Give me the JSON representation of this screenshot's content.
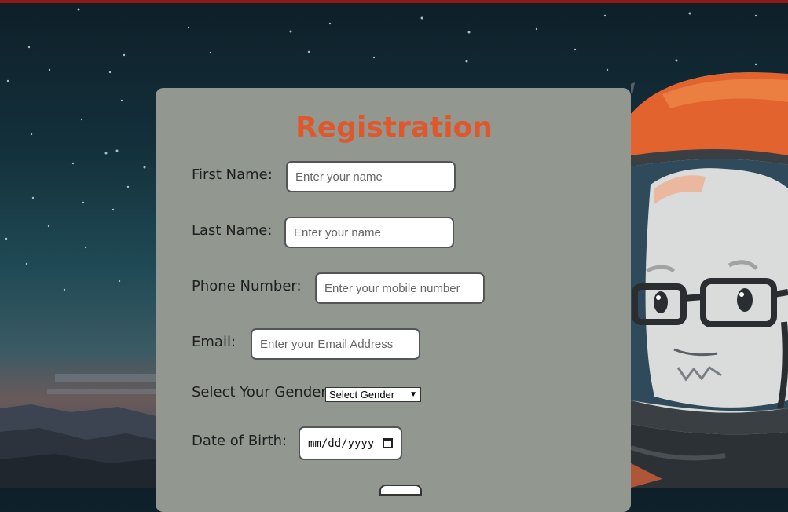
{
  "form": {
    "title": "Registration",
    "first_name": {
      "label": "First Name:",
      "placeholder": "Enter your name"
    },
    "last_name": {
      "label": "Last Name:",
      "placeholder": "Enter your name"
    },
    "phone": {
      "label": "Phone Number:",
      "placeholder": "Enter your mobile number"
    },
    "email": {
      "label": "Email:",
      "placeholder": "Enter your Email Address"
    },
    "gender": {
      "label": "Select Your Gender:",
      "selected": "Select Gender"
    },
    "dob": {
      "label": "Date of Birth:",
      "value": "mm/dd/yyyy"
    }
  },
  "icons": {
    "dropdown": "chevron-down-icon",
    "calendar": "calendar-icon"
  },
  "colors": {
    "title": "#e0572b",
    "card": "#929790",
    "top_bar": "#8b1c1c"
  }
}
